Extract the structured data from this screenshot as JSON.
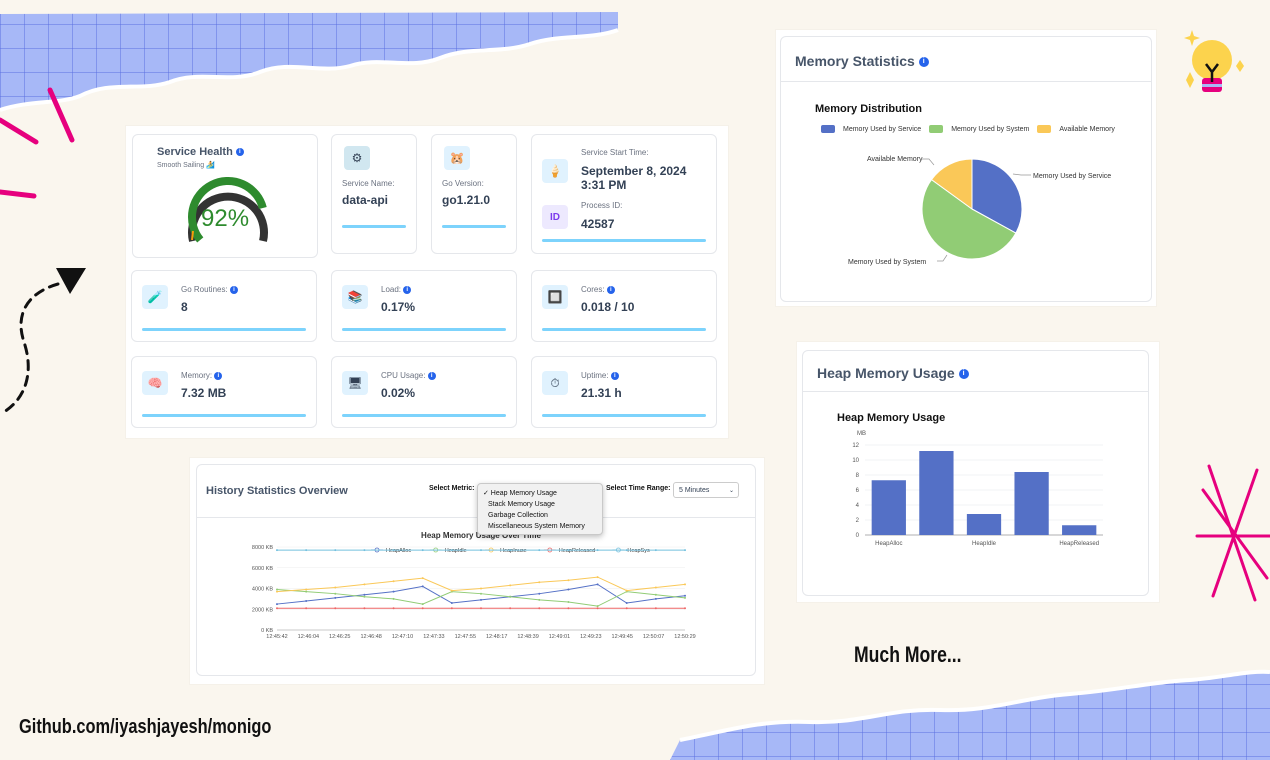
{
  "service_health": {
    "title": "Service Health",
    "subtitle": "Smooth Sailing 🏄",
    "percent_label": "92%",
    "percent": 92
  },
  "service_name": {
    "label": "Service Name:",
    "value": "data-api"
  },
  "go_version": {
    "label": "Go Version:",
    "value": "go1.21.0"
  },
  "start_time": {
    "label": "Service Start Time:",
    "line1": "September 8, 2024",
    "line2": "3:31 PM"
  },
  "process_id": {
    "label": "Process ID:",
    "value": "42587"
  },
  "go_routines": {
    "label": "Go Routines:",
    "value": "8"
  },
  "load": {
    "label": "Load:",
    "value": "0.17%"
  },
  "cores": {
    "label": "Cores:",
    "value": "0.018 / 10"
  },
  "memory": {
    "label": "Memory:",
    "value": "7.32 MB"
  },
  "cpu_usage": {
    "label": "CPU Usage:",
    "value": "0.02%"
  },
  "uptime": {
    "label": "Uptime:",
    "value": "21.31 h"
  },
  "memory_statistics": {
    "title": "Memory Statistics",
    "chart_title": "Memory Distribution",
    "legend": [
      "Memory Used by Service",
      "Memory Used by System",
      "Available Memory"
    ],
    "callouts": {
      "available": "Available Memory",
      "service": "Memory Used by Service",
      "system": "Memory Used by System"
    }
  },
  "heap_memory": {
    "title": "Heap Memory Usage",
    "chart_title": "Heap Memory Usage",
    "unit": "MB"
  },
  "history": {
    "title": "History Statistics Overview",
    "metric_label": "Select Metric:",
    "time_label": "Select Time Range:",
    "time_value": "5 Minutes",
    "metric_options": [
      "✓ Heap Memory Usage",
      "Stack Memory Usage",
      "Garbage Collection",
      "Miscellaneous System Memory"
    ],
    "chart_title": "Heap Memory Usage Over Time"
  },
  "footer": {
    "github": "Github.com/iyashjayesh/monigo",
    "much_more": "Much More..."
  },
  "colors": {
    "blue": "#5470c6",
    "green": "#91cc75",
    "yellow": "#fac858",
    "red": "#ee6666",
    "cyan": "#73c0de",
    "gauge": "#2e8b2e",
    "pink": "#e6007e",
    "grid_bg": "#a7b8f7"
  },
  "chart_data": [
    {
      "type": "pie",
      "title": "Memory Distribution",
      "categories": [
        "Memory Used by Service",
        "Memory Used by System",
        "Available Memory"
      ],
      "values": [
        33,
        52,
        15
      ],
      "colors": [
        "#5470c6",
        "#91cc75",
        "#fac858"
      ]
    },
    {
      "type": "bar",
      "title": "Heap Memory Usage",
      "ylabel": "MB",
      "categories": [
        "HeapAlloc",
        "HeapIdle",
        "HeapInuse",
        "HeapReleased",
        "HeapSys"
      ],
      "x_tick_labels": [
        "HeapAlloc",
        "",
        "HeapIdle",
        "",
        "HeapReleased"
      ],
      "values": [
        7.3,
        11.2,
        2.8,
        8.4,
        1.3
      ],
      "ylim": [
        0,
        12
      ],
      "yticks": [
        0,
        2,
        4,
        6,
        8,
        10,
        12
      ]
    },
    {
      "type": "line",
      "title": "Heap Memory Usage Over Time",
      "x": [
        "12:45:42",
        "12:46:04",
        "12:46:25",
        "12:46:48",
        "12:47:10",
        "12:47:33",
        "12:47:55",
        "12:48:17",
        "12:48:39",
        "12:49:01",
        "12:49:23",
        "12:49:45",
        "12:50:07",
        "12:50:29"
      ],
      "ylim": [
        0,
        8000
      ],
      "yticks": [
        "0 KB",
        "2000 KB",
        "4000 KB",
        "6000 KB",
        "8000 KB"
      ],
      "series": [
        {
          "name": "HeapAlloc",
          "color": "#5470c6",
          "values": [
            2500,
            2800,
            3100,
            3400,
            3700,
            4200,
            2600,
            2900,
            3200,
            3500,
            3900,
            4400,
            2600,
            3000,
            3300
          ]
        },
        {
          "name": "HeapIdle",
          "color": "#91cc75",
          "values": [
            3900,
            3700,
            3500,
            3200,
            3000,
            2500,
            3700,
            3500,
            3200,
            2900,
            2700,
            2300,
            3700,
            3400,
            3100
          ]
        },
        {
          "name": "HeapInuse",
          "color": "#fac858",
          "values": [
            3700,
            3900,
            4100,
            4400,
            4700,
            5000,
            3800,
            4000,
            4300,
            4600,
            4800,
            5100,
            3800,
            4100,
            4400
          ]
        },
        {
          "name": "HeapReleased",
          "color": "#ee6666",
          "values": [
            2100,
            2100,
            2100,
            2100,
            2100,
            2100,
            2100,
            2100,
            2100,
            2100,
            2100,
            2100,
            2100,
            2100,
            2100
          ]
        },
        {
          "name": "HeapSys",
          "color": "#73c0de",
          "values": [
            7700,
            7700,
            7700,
            7700,
            7700,
            7700,
            7700,
            7700,
            7700,
            7700,
            7700,
            7700,
            7700,
            7700,
            7700
          ]
        }
      ]
    }
  ]
}
